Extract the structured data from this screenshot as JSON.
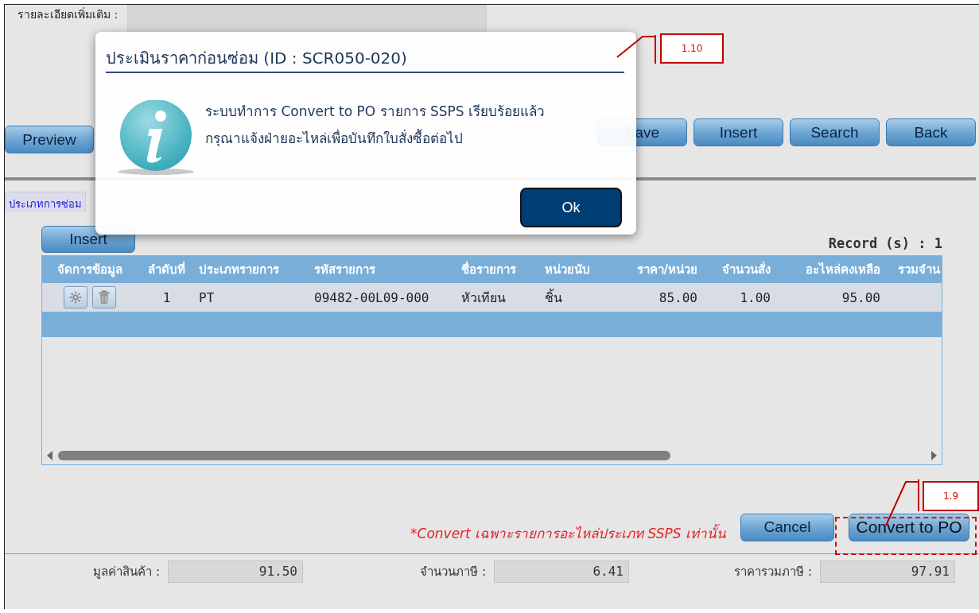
{
  "background_form": {
    "field_label": "รายละเอียดเพิ่มเติม :"
  },
  "toolbar": {
    "left_buttons": [
      "Preview"
    ],
    "right_buttons": [
      "Save",
      "Insert",
      "Search",
      "Back"
    ]
  },
  "tabs": [
    {
      "label": "ประเภทการซ่อม",
      "selected": false
    }
  ],
  "grid": {
    "insert_button": "Insert",
    "record_count": "Record (s) : 1",
    "columns": [
      "จัดการข้อมูล",
      "ลำดับที่",
      "ประเภทรายการ",
      "รหัสรายการ",
      "ชื่อรายการ",
      "หน่วยนับ",
      "ราคา/หน่วย",
      "จำนวนสั่ง",
      "อะไหล่คงเหลือ",
      "รวมจำน"
    ],
    "rows": [
      {
        "cells": [
          "",
          "1",
          "PT",
          "09482-00L09-000",
          "หัวเทียน",
          "ชิ้น",
          "85.00",
          "1.00",
          "95.00"
        ]
      }
    ]
  },
  "footer": {
    "note": "*Convert เฉพาะรายการอะไหล่ประเภท SSPS เท่านั้น",
    "buttons": [
      "Cancel",
      "Convert to PO"
    ]
  },
  "totals": [
    {
      "label": "มูลค่าสินค้า :",
      "value": "91.50"
    },
    {
      "label": "จำนวนภาษี :",
      "value": "6.41"
    },
    {
      "label": "ราคารวมภาษี :",
      "value": "97.91"
    }
  ],
  "dialog": {
    "title": "ประเมินราคาก่อนซ่อม (ID : SCR050-020)",
    "message_lines": [
      "ระบบทำการ Convert to PO รายการ SSPS เรียบร้อยแล้ว",
      "กรุณาแจ้งฝ่ายอะไหล่เพื่อบันทึกใบสั่งซื้อต่อไป"
    ],
    "ok_button": "Ok"
  },
  "annotations": [
    {
      "label": "1.10"
    },
    {
      "label": "1.9"
    }
  ]
}
